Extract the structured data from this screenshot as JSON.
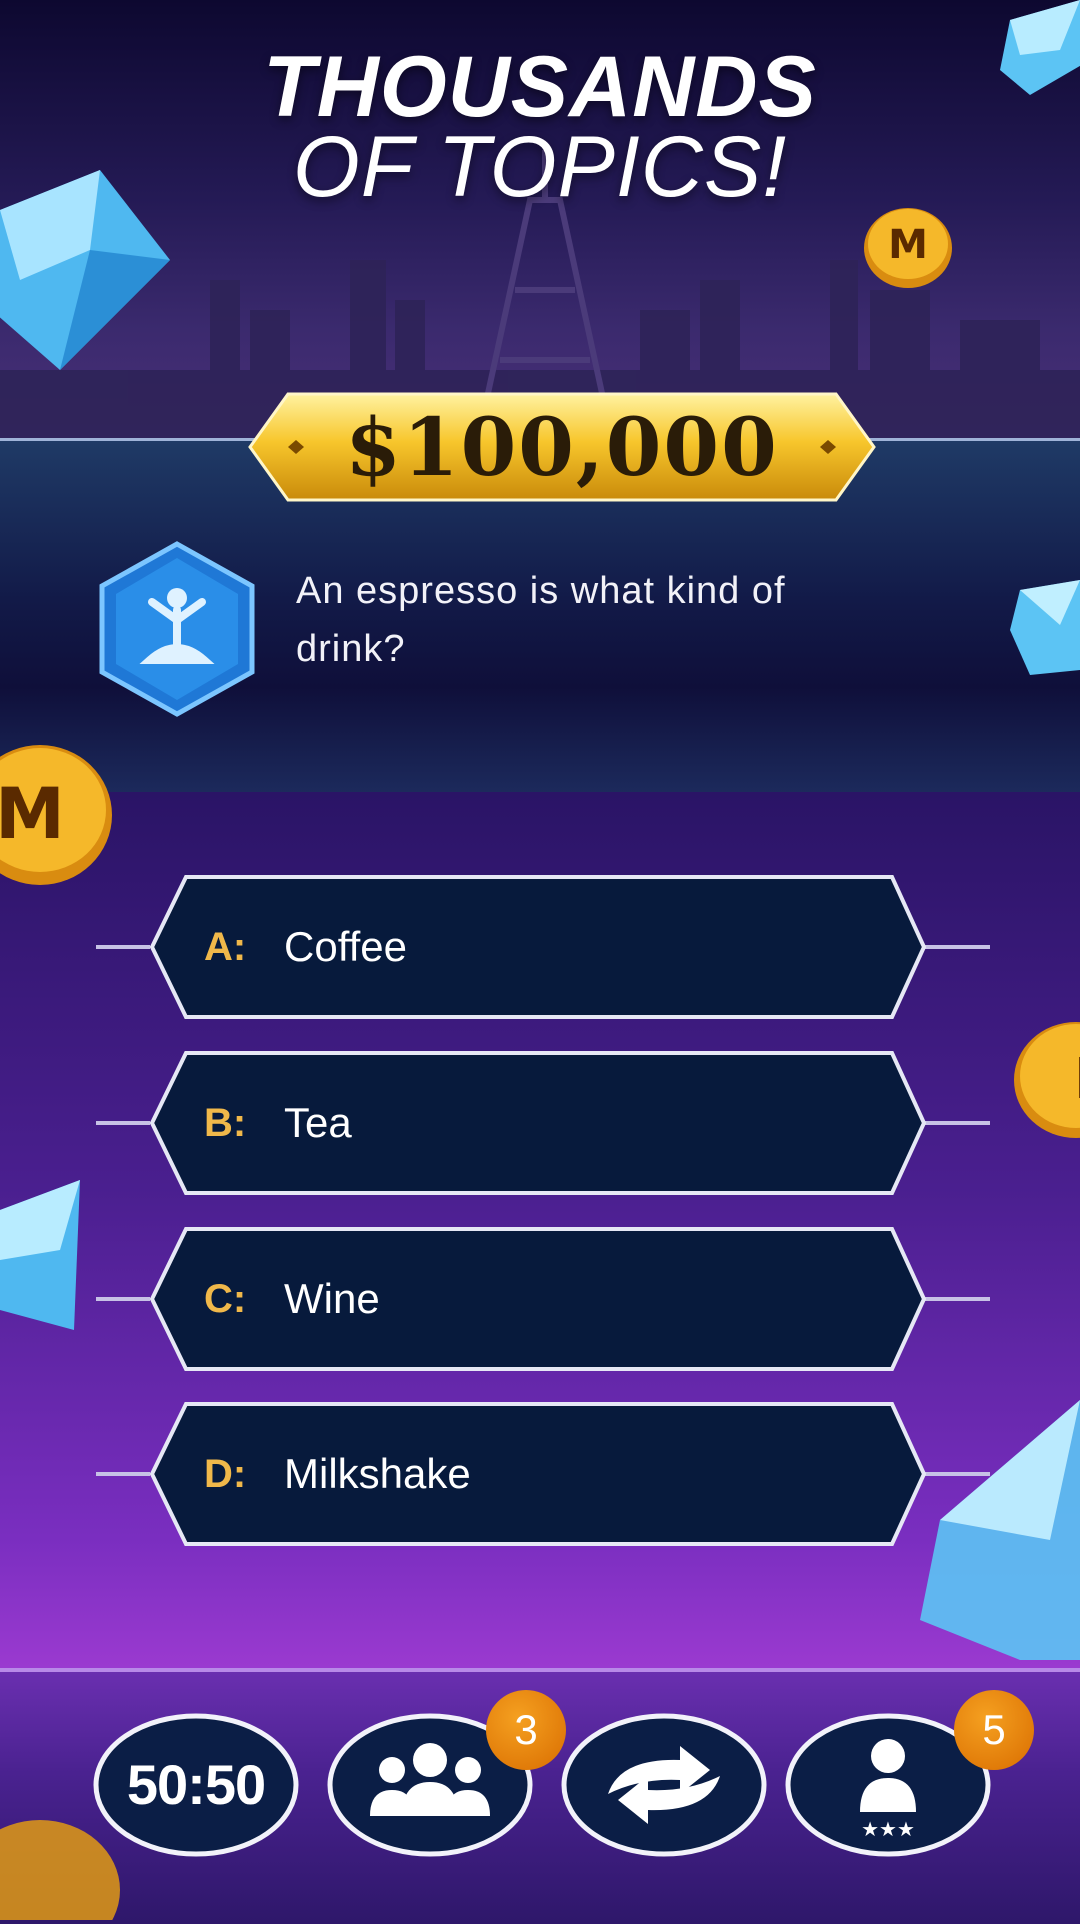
{
  "headline": {
    "line1": "THOUSANDS",
    "line2": "OF TOPICS!"
  },
  "prize": "$100,000",
  "question": {
    "text": "An espresso is what kind of drink?",
    "topic_icon": "meditation-icon"
  },
  "answers": [
    {
      "letter": "A:",
      "text": "Coffee"
    },
    {
      "letter": "B:",
      "text": "Tea"
    },
    {
      "letter": "C:",
      "text": "Wine"
    },
    {
      "letter": "D:",
      "text": "Milkshake"
    }
  ],
  "lifelines": {
    "fifty_fifty": {
      "label": "50:50"
    },
    "ask_audience": {
      "icon": "audience-icon",
      "count": "3"
    },
    "switch_question": {
      "icon": "swap-arrows-icon"
    },
    "ask_expert": {
      "icon": "expert-icon",
      "count": "5"
    }
  },
  "colors": {
    "gold": "#f0b84a",
    "badge_orange": "#e07800",
    "answer_fill": "#071a3c",
    "background_purple": "#7a2ec0"
  }
}
